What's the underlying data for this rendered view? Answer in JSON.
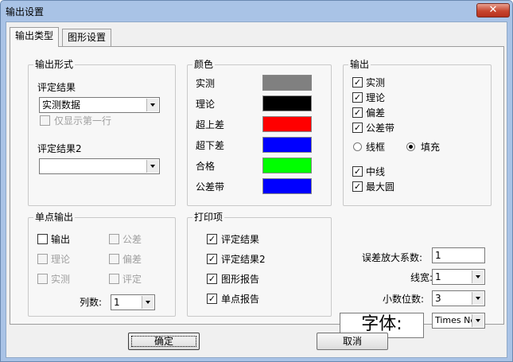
{
  "window": {
    "title": "输出设置",
    "close_label": "✕"
  },
  "tabs": [
    {
      "label": "输出类型"
    },
    {
      "label": "图形设置"
    }
  ],
  "output_form": {
    "legend": "输出形式",
    "eval_label": "评定结果",
    "eval_value": "实测数据",
    "first_row_only": "仅显示第一行",
    "eval2_label": "评定结果2",
    "eval2_value": ""
  },
  "colors": {
    "legend": "颜色",
    "items": [
      {
        "label": "实测",
        "color": "#808080"
      },
      {
        "label": "理论",
        "color": "#000000"
      },
      {
        "label": "超上差",
        "color": "#ff0000"
      },
      {
        "label": "超下差",
        "color": "#0000ff"
      },
      {
        "label": "合格",
        "color": "#00ff00"
      },
      {
        "label": "公差带",
        "color": "#0000ff"
      }
    ]
  },
  "output": {
    "legend": "输出",
    "checks": [
      {
        "label": "实测",
        "checked": true
      },
      {
        "label": "理论",
        "checked": true
      },
      {
        "label": "偏差",
        "checked": true
      },
      {
        "label": "公差带",
        "checked": true
      }
    ],
    "radio_wireframe": "线框",
    "radio_fill": "填充",
    "checks2": [
      {
        "label": "中线",
        "checked": true
      },
      {
        "label": "最大圆",
        "checked": true
      }
    ]
  },
  "single_point": {
    "legend": "单点输出",
    "items": [
      {
        "label": "输出",
        "checked": false,
        "enabled": true
      },
      {
        "label": "公差",
        "checked": false,
        "enabled": false
      },
      {
        "label": "理论",
        "checked": false,
        "enabled": false
      },
      {
        "label": "偏差",
        "checked": false,
        "enabled": false
      },
      {
        "label": "实测",
        "checked": false,
        "enabled": false
      },
      {
        "label": "评定",
        "checked": false,
        "enabled": false
      }
    ],
    "columns_label": "列数:",
    "columns_value": "1"
  },
  "print_items": {
    "legend": "打印项",
    "items": [
      {
        "label": "评定结果",
        "checked": true
      },
      {
        "label": "评定结果2",
        "checked": true
      },
      {
        "label": "图形报告",
        "checked": true
      },
      {
        "label": "单点报告",
        "checked": true
      }
    ]
  },
  "settings": {
    "error_factor_label": "误差放大系数:",
    "error_factor_value": "1",
    "line_width_label": "线宽:",
    "line_width_value": "1",
    "decimals_label": "小数位数:",
    "decimals_value": "3",
    "font_preview": "字体:",
    "font_value": "Times New"
  },
  "buttons": {
    "ok": "确定",
    "cancel": "取消"
  }
}
